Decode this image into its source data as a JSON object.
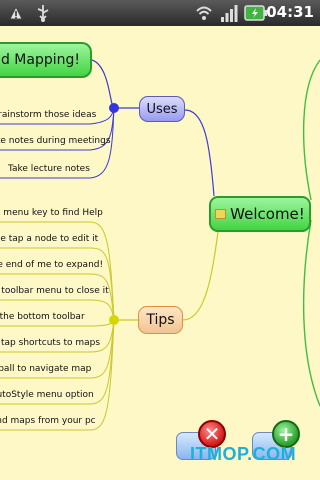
{
  "status_bar": {
    "time": "04:31",
    "icons": [
      "usb-debugging-icon",
      "usb-icon",
      "wifi-icon",
      "signal-icon",
      "battery-icon"
    ]
  },
  "mind_map": {
    "root": {
      "label": "Mind Mapping!"
    },
    "central": {
      "label": "Welcome!"
    },
    "uses": {
      "label": "Uses",
      "items": [
        "Brainstorm those ideas",
        "Take notes during meetings",
        "Take lecture notes"
      ]
    },
    "tips": {
      "label": "Tips",
      "items": [
        "Use the menu key to find Help",
        "Double tap a node to edit it",
        "Tap the end of me to expand!",
        "Use the toolbar menu to close it",
        "Long press the bottom toolbar",
        "Pinch or tap shortcuts to maps",
        "Use the trackball to navigate map",
        "Use the AutoStyle menu option",
        "Import and maps from your pc"
      ]
    }
  },
  "toolbar": {
    "delete_icon": "delete-node-icon",
    "add_icon": "add-node-icon"
  },
  "watermark": "ITMOP.COM",
  "colors": {
    "background": "#fdf8c6",
    "green_node": "#43d443",
    "uses_link": "#3b3bd6",
    "tips_link": "#d6d62a"
  }
}
